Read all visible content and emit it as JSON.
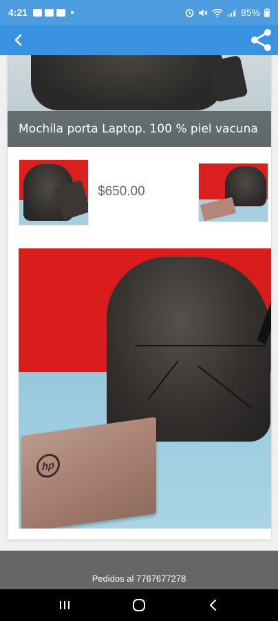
{
  "status_bar": {
    "time": "4:21",
    "battery": "85%",
    "icons": [
      "message-icon",
      "image-icon",
      "mail-icon",
      "dot-icon",
      "alarm-icon",
      "mute-icon",
      "wifi-icon",
      "signal-icon",
      "battery-icon"
    ]
  },
  "app_bar": {
    "back_icon": "chevron-left-icon",
    "share_icon": "share-icon",
    "color": "#3a93e0"
  },
  "product": {
    "title": "Mochila porta Laptop. 100 % piel vacuna",
    "price": "$650.00",
    "thumbnails": [
      "open-backpack-photo",
      "backpack-with-laptop-photo"
    ],
    "main_image": "backpack-with-hp-laptop-photo"
  },
  "footer": {
    "text": "Pedidos al 7767677278"
  },
  "nav_bar": {
    "buttons": [
      "recents-icon",
      "home-icon",
      "back-icon"
    ]
  },
  "colors": {
    "status_bar": "#4d9de0",
    "footer": "#666666",
    "price_text": "#666666",
    "photo_red": "#d91c1c",
    "photo_blue": "#a9d4e6"
  }
}
